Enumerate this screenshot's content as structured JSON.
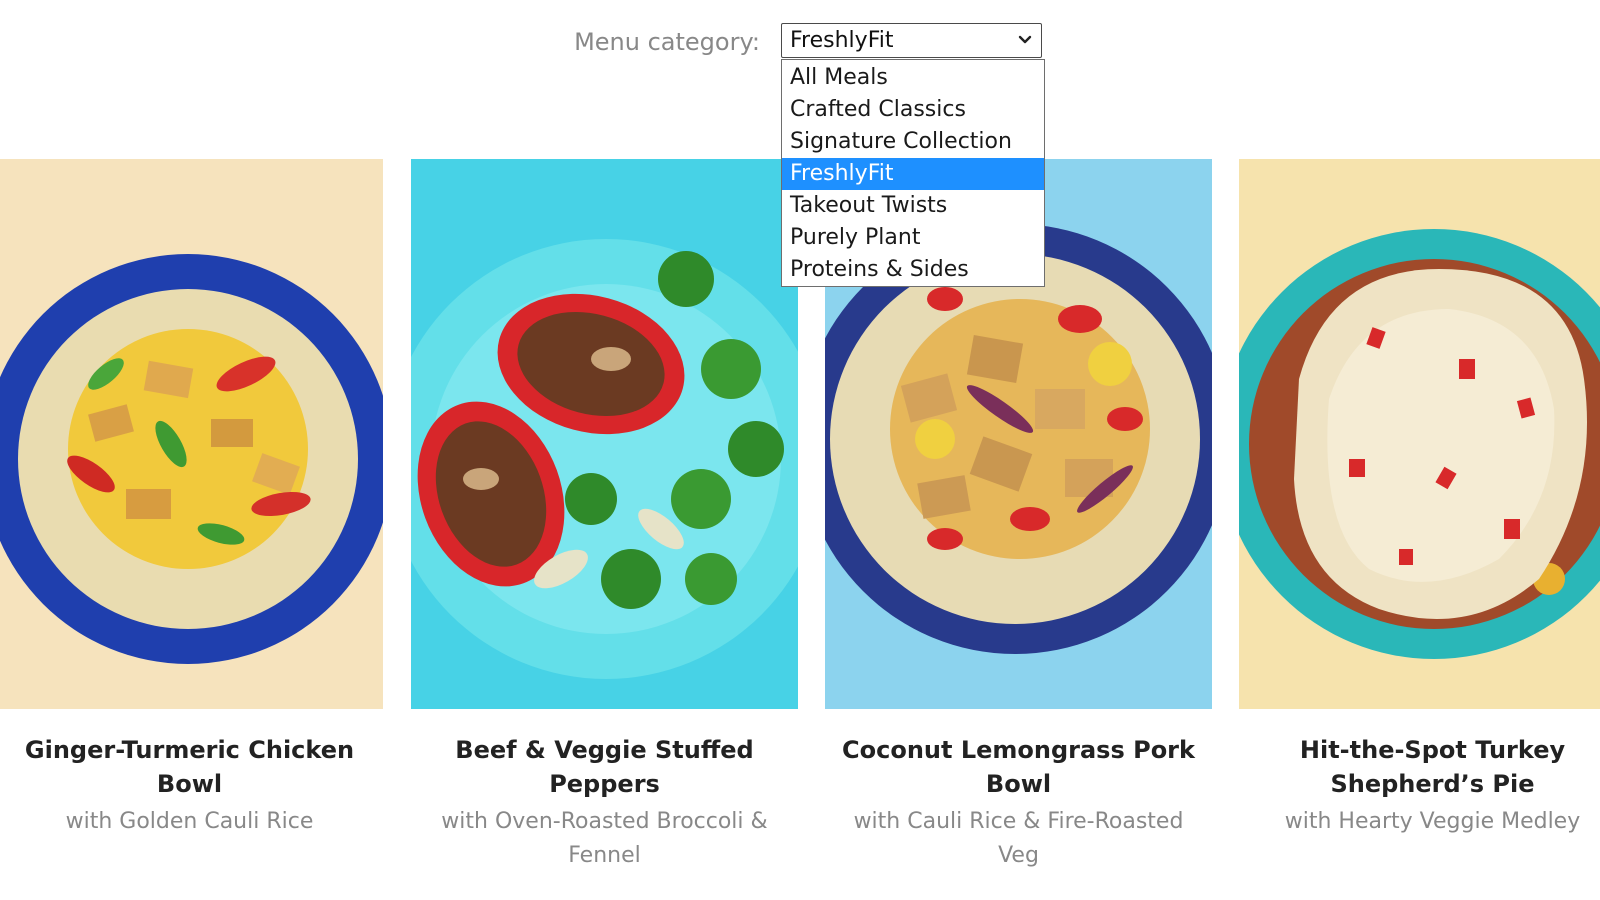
{
  "filter": {
    "label": "Menu category:",
    "selected": "FreshlyFit",
    "options": [
      "All Meals",
      "Crafted Classics",
      "Signature Collection",
      "FreshlyFit",
      "Takeout Twists",
      "Purely Plant",
      "Proteins & Sides"
    ],
    "highlight_color": "#1e90ff"
  },
  "meals": [
    {
      "title": "Ginger-Turmeric Chicken Bowl",
      "subtitle": "with Golden Cauli Rice",
      "bg_color": "#f6e3bd",
      "plate_color": "#1f3fae"
    },
    {
      "title": "Beef & Veggie Stuffed Peppers",
      "subtitle": "with Oven-Roasted Broccoli & Fennel",
      "bg_color": "#47d2e6",
      "plate_color": "#63dfe9"
    },
    {
      "title": "Coconut Lemongrass Pork Bowl",
      "subtitle": "with Cauli Rice & Fire-Roasted Veg",
      "bg_color": "#8cd3ee",
      "plate_color": "#283a8c"
    },
    {
      "title": "Hit-the-Spot Turkey Shepherd’s Pie",
      "subtitle": "with Hearty Veggie Medley",
      "bg_color": "#f6e3ad",
      "plate_color": "#2ab7b8"
    }
  ]
}
